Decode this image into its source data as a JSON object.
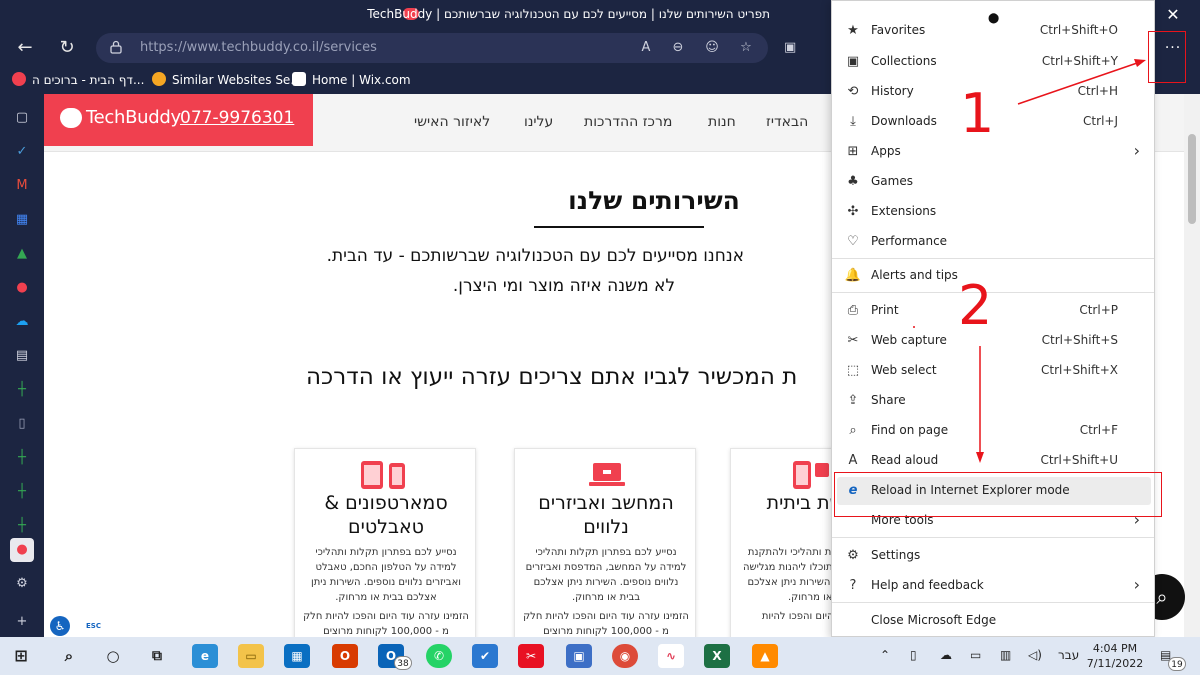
{
  "window": {
    "title": "תפריט השירותים שלנו | מסייעים לכם עם הטכנולוגיה שברשותכם | TechBuddy",
    "close_glyph": "✕"
  },
  "toolbar": {
    "url_host": "https://www.techbuddy.co.il",
    "url_path": "/services",
    "more_glyph": "···"
  },
  "favorites": [
    {
      "label": "דף הבית - ברוכים ה...",
      "color": "#f0404f"
    },
    {
      "label": "Similar Websites Se...",
      "color": "#f5a623"
    },
    {
      "label": "Home | Wix.com",
      "color": "#ffffff"
    }
  ],
  "site": {
    "brand": "TechBuddy",
    "phone": "077-9976301",
    "menu": [
      "הבאדיז",
      "חנות",
      "מרכז ההדרכות",
      "עלינו",
      "לאיזור האישי"
    ],
    "page_title": "השירותים שלנו",
    "intro_line1": "אנחנו מסייעים לכם עם הטכנולוגיה שברשותכם - עד הבית.",
    "intro_line2": "לא משנה איזה מוצר ומי היצרן.",
    "question": "ת המכשיר לגביו אתם צריכים עזרה ייעוץ או הדרכה",
    "cards": [
      {
        "title": "סמארטפונים & טאבלטים",
        "desc": "נסייע לכם בפתרון תקלות ותהליכי למידה על הטלפון החכם, טאבלט ואביזרים נלווים נוספים. השירות ניתן אצלכם בבית או מרחוק.",
        "desc2": "הזמינו עזרה עוד היום והפכו להיות חלק מ - 100,000 לקוחות מרוצים"
      },
      {
        "title": "המחשב ואביזרים נלווים",
        "desc": "נסייע לכם בפתרון תקלות ותהליכי למידה על המחשב, המדפסת ואביזרים נלווים נוספים. השירות ניתן אצלכם בבית או מרחוק.",
        "desc2": "הזמינו עזרה עוד היום והפכו להיות חלק מ - 100,000 לקוחות מרוצים"
      },
      {
        "title": "ט ורשת ביתית",
        "desc": "נו בפתרון תקלות ותהליכי ולהתקנת האינטרנט כדי שתוכלו ליהנות מגלישה חלקה ובטוחה. השירות ניתן אצלכם בבית או מרחוק.",
        "desc2": "ו עזרה עוד היום והפכו להיות"
      }
    ]
  },
  "edge_menu": {
    "items": [
      {
        "label": "Favorites",
        "key": "Ctrl+Shift+O",
        "icon": "★"
      },
      {
        "label": "Collections",
        "key": "Ctrl+Shift+Y",
        "icon": "▣"
      },
      {
        "label": "History",
        "key": "Ctrl+H",
        "icon": "⟲"
      },
      {
        "label": "Downloads",
        "key": "Ctrl+J",
        "icon": "⤓"
      },
      {
        "label": "Apps",
        "key": "",
        "icon": "⊞",
        "arrow": "›"
      },
      {
        "label": "Games",
        "key": "",
        "icon": "♣"
      },
      {
        "label": "Extensions",
        "key": "",
        "icon": "✣"
      },
      {
        "label": "Performance",
        "key": "",
        "icon": "♡"
      },
      {
        "label": "Alerts and tips",
        "key": "",
        "icon": "🔔"
      },
      {
        "label": "Print",
        "key": "Ctrl+P",
        "icon": "⎙"
      },
      {
        "label": "Web capture",
        "key": "Ctrl+Shift+S",
        "icon": "✂"
      },
      {
        "label": "Web select",
        "key": "Ctrl+Shift+X",
        "icon": "⬚"
      },
      {
        "label": "Share",
        "key": "",
        "icon": "⇪"
      },
      {
        "label": "Find on page",
        "key": "Ctrl+F",
        "icon": "⌕"
      },
      {
        "label": "Read aloud",
        "key": "Ctrl+Shift+U",
        "icon": "A"
      },
      {
        "label": "Reload in Internet Explorer mode",
        "key": "",
        "icon": "e"
      },
      {
        "label": "More tools",
        "key": "",
        "icon": "",
        "arrow": "›"
      },
      {
        "label": "Settings",
        "key": "",
        "icon": "⚙"
      },
      {
        "label": "Help and feedback",
        "key": "",
        "icon": "?",
        "arrow": "›"
      },
      {
        "label": "Close Microsoft Edge",
        "key": "",
        "icon": ""
      }
    ]
  },
  "annotations": {
    "step1": "1",
    "step2": "2",
    "color": "#e8141b"
  },
  "taskbar": {
    "lang": "עבר",
    "time": "4:04 PM",
    "date": "7/11/2022",
    "badge_outlook": "38",
    "badge_notif": "19"
  },
  "sidebar": {
    "esc": "ESC"
  }
}
